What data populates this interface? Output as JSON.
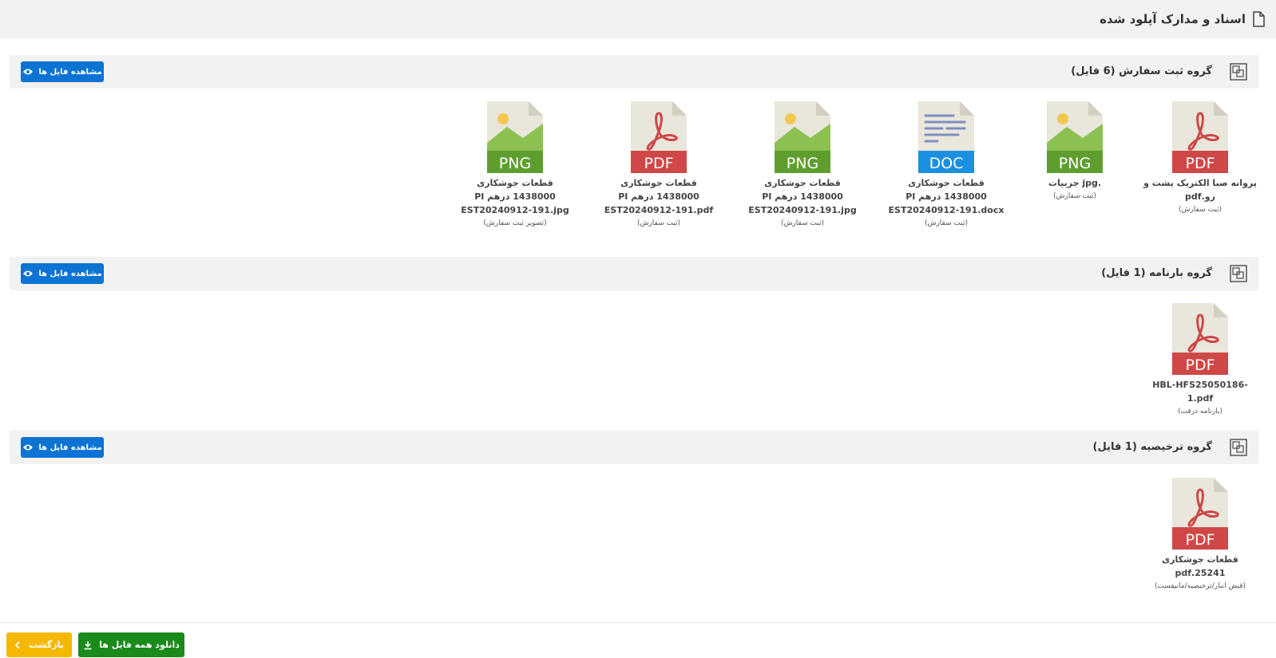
{
  "page": {
    "title": "اسناد و مدارک آپلود شده",
    "icon": "document-icon"
  },
  "colors": {
    "view_button": "#0b73d3",
    "download_button": "#1a8a1a",
    "back_button": "#f5b800",
    "header_bg": "#f2f2f2"
  },
  "groups": [
    {
      "title": "گروه ثبت سفارش (6 فایل)",
      "view_label": "مشاهده فایل ها",
      "files": [
        {
          "type": "PDF",
          "name": "پروانه صبا الکتریک پشت و رو.pdf",
          "category": "(ثبت سفارش)"
        },
        {
          "type": "PNG",
          "name": ".jpg جزییات",
          "category": "(ثبت سفارش)"
        },
        {
          "type": "DOC",
          "name": "قطعات جوشکاری 1438000 درهم PI EST20240912-191.docx",
          "category": "(ثبت سفارش)"
        },
        {
          "type": "PNG",
          "name": "قطعات جوشکاری 1438000 درهم PI EST20240912-191.jpg",
          "category": "(ثبت سفارش)"
        },
        {
          "type": "PDF",
          "name": "قطعات جوشکاری 1438000 درهم PI EST20240912-191.pdf",
          "category": "(ثبت سفارش)"
        },
        {
          "type": "PNG",
          "name": "قطعات جوشکاری 1438000 درهم PI EST20240912-191.jpg",
          "category": "(تصویر ثبت سفارش)"
        }
      ]
    },
    {
      "title": "گروه بارنامه (1 فایل)",
      "view_label": "مشاهده فایل ها",
      "files": [
        {
          "type": "PDF",
          "name": "HBL-HFS25050186-1.pdf",
          "category": "(بارنامه درفت)"
        }
      ]
    },
    {
      "title": "گروه ترخیصیه (1 فایل)",
      "view_label": "مشاهده فایل ها",
      "files": [
        {
          "type": "PDF",
          "name": "قطعات جوشکاری 25241.pdf",
          "category": "(قبض انبار/ترخیصیه/مانیفست)"
        }
      ]
    }
  ],
  "footer": {
    "download_all_label": "دانلود همه فایل ها",
    "back_label": "بازگشت"
  }
}
